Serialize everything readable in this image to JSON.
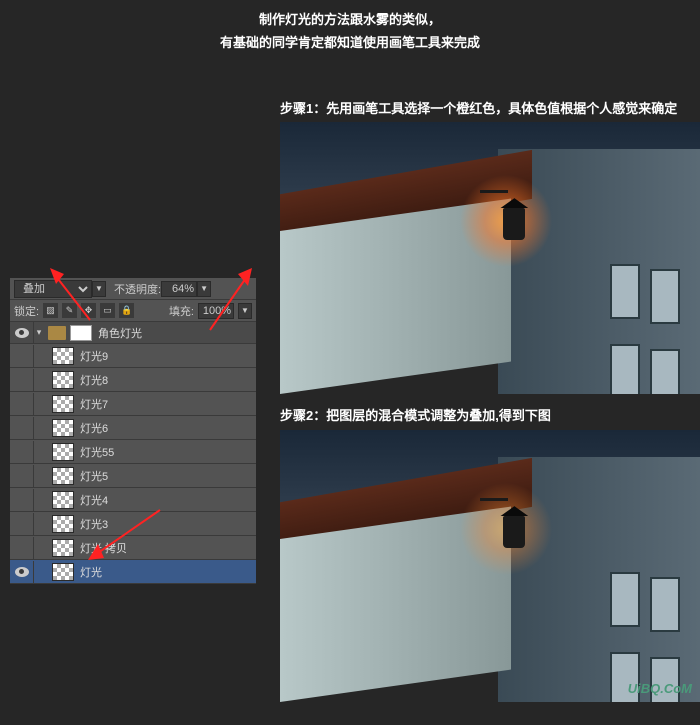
{
  "intro": {
    "line1": "制作灯光的方法跟水雾的类似，",
    "line2": "有基础的同学肯定都知道使用画笔工具来完成"
  },
  "steps": {
    "step1": "步骤1：先用画笔工具选择一个橙红色，具体色值根据个人感觉来确定",
    "step2": "步骤2：把图层的混合模式调整为叠加,得到下图"
  },
  "panel": {
    "blend_mode": "叠加",
    "opacity_label": "不透明度:",
    "opacity_value": "64%",
    "lock_label": "锁定:",
    "fill_label": "填充:",
    "fill_value": "100%",
    "group_name": "角色灯光",
    "layers": [
      {
        "name": "灯光9"
      },
      {
        "name": "灯光8"
      },
      {
        "name": "灯光7"
      },
      {
        "name": "灯光6"
      },
      {
        "name": "灯光55"
      },
      {
        "name": "灯光5"
      },
      {
        "name": "灯光4"
      },
      {
        "name": "灯光3"
      },
      {
        "name": "灯光 拷贝"
      },
      {
        "name": "灯光"
      }
    ]
  },
  "watermark": "UiBQ.CoM",
  "colors": {
    "accent_glow": "#ff9933",
    "arrow": "#ff2222",
    "selected_layer": "#3a5a8a"
  }
}
